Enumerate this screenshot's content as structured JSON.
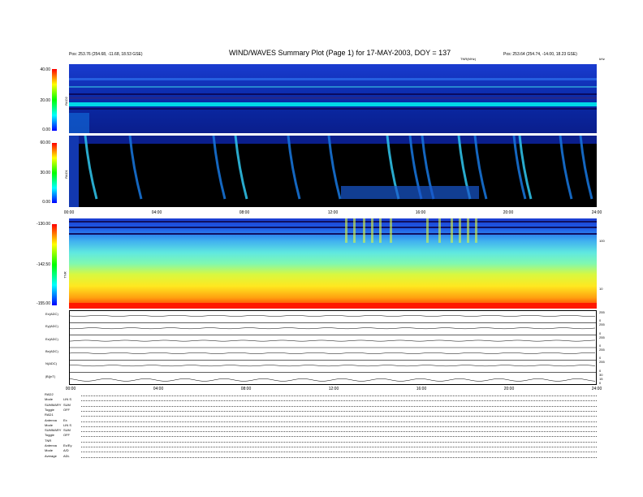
{
  "header": {
    "title": "WIND/WAVES Summary Plot (Page 1) for 17-MAY-2003, DOY = 137",
    "left_line1": "",
    "left_line2": "",
    "left_pos": "Pos:   253.76 (254.68, -11.68, 18.53 GSE)",
    "right_line1": "",
    "right_line2": "",
    "right_pos": "Pos:   253.64 (254.74, -14.00, 18.23 GSE)",
    "units_right": "kHz",
    "tnr_label_top": "TNR(MHz)"
  },
  "panels": {
    "rad2_label": "RAD2",
    "rad1_label": "RAD1",
    "tnr_label": "TNR"
  },
  "chart_data": [
    {
      "type": "heatmap",
      "name": "RAD2",
      "y_ticks": [
        "40.00",
        "20.00",
        "0.00"
      ],
      "colorscale": [
        "#0000ff",
        "#00ffff",
        "#ffff00",
        "#ff0000"
      ],
      "xlim": [
        0,
        24
      ]
    },
    {
      "type": "heatmap",
      "name": "RAD1",
      "y_ticks": [
        "60.00",
        "30.00",
        "0.00"
      ],
      "x_ticks": [
        "00:00",
        "04:00",
        "08:00",
        "12:00",
        "16:00",
        "20:00",
        "24:00"
      ],
      "xlim": [
        0,
        24
      ]
    },
    {
      "type": "heatmap",
      "name": "TNR",
      "y_ticks": [
        "-130.00",
        "-142.50",
        "-155.00"
      ],
      "right_ticks": [
        "100",
        "10"
      ],
      "xlim": [
        0,
        24
      ]
    },
    {
      "type": "line",
      "name": "Rate panels",
      "rows": [
        {
          "label": "Ex(ADC)",
          "right_ticks": [
            "255",
            "0"
          ]
        },
        {
          "label": "Ey(ADC)",
          "right_ticks": [
            "255",
            "0"
          ]
        },
        {
          "label": "Ez(ADC)",
          "right_ticks": [
            "255",
            "0"
          ]
        },
        {
          "label": "Bx(ADC)",
          "right_ticks": [
            "255",
            "0"
          ]
        },
        {
          "label": "N(ADC)",
          "right_ticks": [
            "255",
            "0"
          ]
        },
        {
          "label": "|B|(nT)",
          "right_ticks": [
            "30",
            "15",
            "0"
          ]
        }
      ],
      "x_ticks": [
        "00:00",
        "04:00",
        "08:00",
        "12:00",
        "16:00",
        "20:00",
        "24:00"
      ]
    }
  ],
  "params": [
    {
      "k": "RAD2",
      "v": ""
    },
    {
      "k": "Mode",
      "v": "LIN S"
    },
    {
      "k": "SUMMARY",
      "v": "SUM"
    },
    {
      "k": "Toggle",
      "v": "OFF"
    },
    {
      "k": "RAD1",
      "v": ""
    },
    {
      "k": "Antenna",
      "v": "Ex"
    },
    {
      "k": "Mode",
      "v": "LIN S"
    },
    {
      "k": "SUMMARY",
      "v": "SUM"
    },
    {
      "k": "Toggle",
      "v": "OFF"
    },
    {
      "k": "TNR",
      "v": ""
    },
    {
      "k": "Antenna",
      "v": "Ex/Ey"
    },
    {
      "k": "Mode",
      "v": "A/D"
    },
    {
      "k": "Average",
      "v": "ADL"
    }
  ]
}
